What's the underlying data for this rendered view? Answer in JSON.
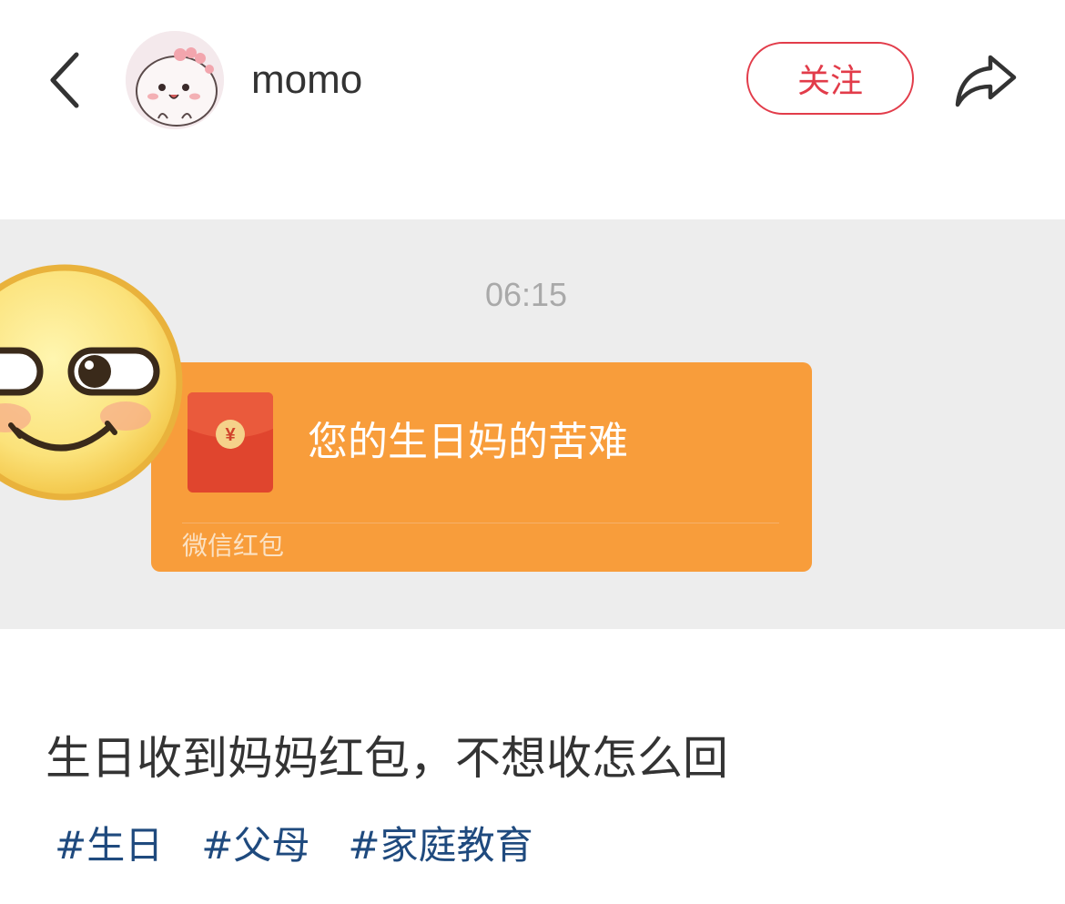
{
  "header": {
    "back_icon": "chevron-left-icon",
    "username": "momo",
    "follow_label": "关注",
    "share_icon": "share-arrow-icon"
  },
  "post_image": {
    "chat_time": "06:15",
    "red_packet": {
      "title": "您的生日妈的苦难",
      "footer": "微信红包",
      "currency_symbol": "¥"
    }
  },
  "post": {
    "title": "生日收到妈妈红包，不想收怎么回",
    "tags": [
      "#生日",
      "#父母",
      "#家庭教育"
    ]
  },
  "colors": {
    "accent_red": "#e23c4a",
    "red_packet_orange": "#f89d3b",
    "red_packet_envelope": "#e0452e",
    "tag_blue": "#1f4a7e",
    "chat_background": "#ededed"
  }
}
